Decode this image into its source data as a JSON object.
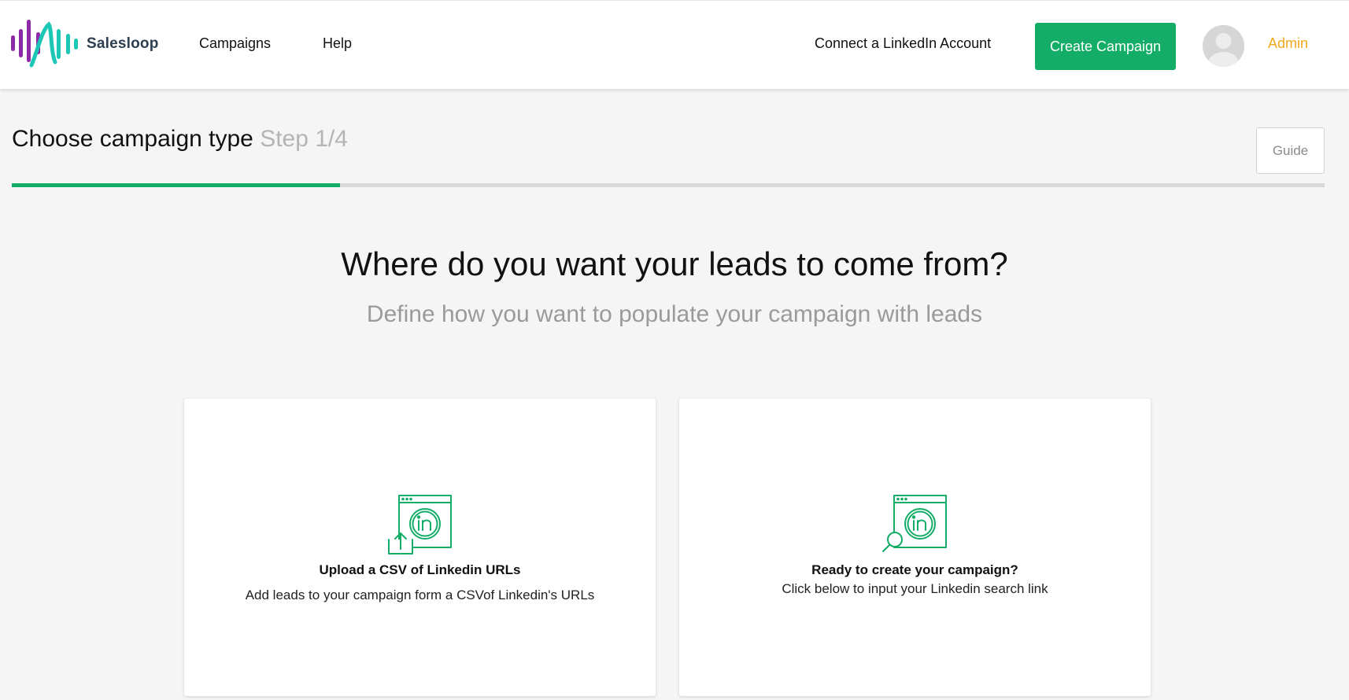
{
  "header": {
    "brand": "Salesloop",
    "nav": {
      "campaigns": "Campaigns",
      "help": "Help",
      "connect_linkedin": "Connect a LinkedIn Account"
    },
    "create_button": "Create Campaign",
    "user_name": "Admin",
    "colors": {
      "primary": "#13ad67",
      "user_name": "#f0a81c",
      "logo_purple": "#8e2aa8",
      "logo_teal": "#1cc8b5"
    }
  },
  "step": {
    "title": "Choose campaign type",
    "step_label": "Step 1/4",
    "progress_fraction": 0.25,
    "guide_button": "Guide"
  },
  "main": {
    "headline": "Where do you want your leads to come from?",
    "subheadline": "Define how you want to populate your campaign with leads"
  },
  "cards": [
    {
      "icon": "linkedin-upload-icon",
      "title": "Upload a CSV of Linkedin URLs",
      "description": "Add leads to your campaign form a CSVof Linkedin's URLs"
    },
    {
      "icon": "linkedin-search-icon",
      "title": "Ready to create your campaign?",
      "description": "Click below to input your Linkedin search link"
    }
  ]
}
